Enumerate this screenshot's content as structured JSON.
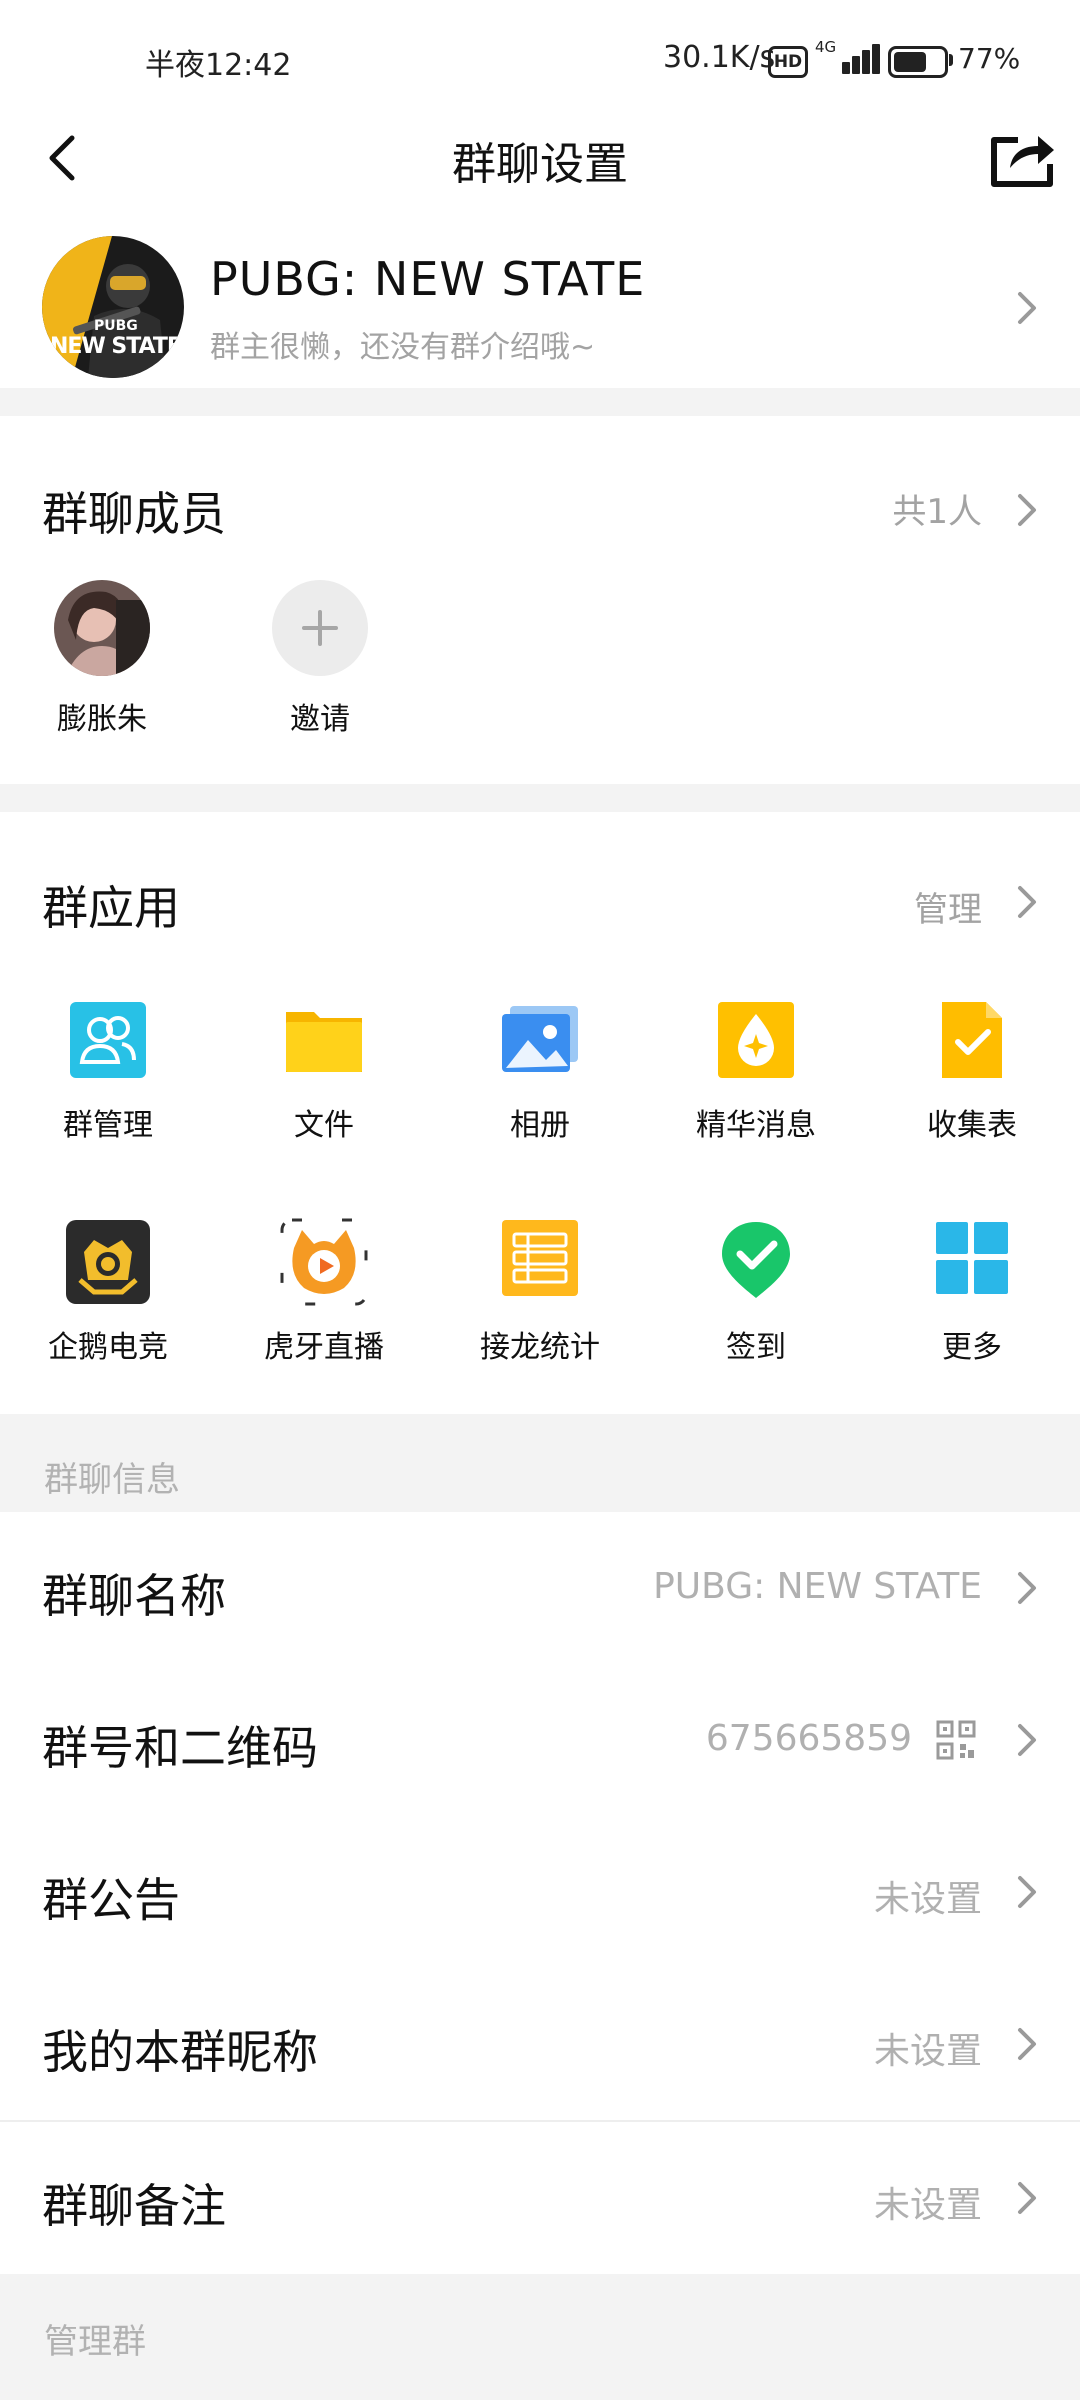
{
  "status_bar": {
    "time": "半夜12:42",
    "net_speed": "30.1K/s",
    "hd": "HD",
    "network": "4G",
    "battery": "77%",
    "battery_level": 0.77
  },
  "header": {
    "title": "群聊设置"
  },
  "group": {
    "name": "PUBG: NEW STATE",
    "intro": "群主很懒，还没有群介绍哦~",
    "avatar_text_top": "PUBG",
    "avatar_text_bottom": "NEW STATE"
  },
  "members": {
    "title": "群聊成员",
    "count": "共1人",
    "list": [
      {
        "name": "膨胀朱"
      },
      {
        "name": "邀请"
      }
    ]
  },
  "apps": {
    "title": "群应用",
    "manage": "管理",
    "items": [
      {
        "label": "群管理",
        "icon": "group-manage-icon"
      },
      {
        "label": "文件",
        "icon": "folder-icon"
      },
      {
        "label": "相册",
        "icon": "photo-album-icon"
      },
      {
        "label": "精华消息",
        "icon": "essence-message-icon"
      },
      {
        "label": "收集表",
        "icon": "collect-form-icon"
      },
      {
        "label": "企鹅电竞",
        "icon": "penguin-esports-icon"
      },
      {
        "label": "虎牙直播",
        "icon": "huya-live-icon"
      },
      {
        "label": "接龙统计",
        "icon": "chain-stats-icon"
      },
      {
        "label": "签到",
        "icon": "check-in-icon"
      },
      {
        "label": "更多",
        "icon": "more-grid-icon"
      }
    ]
  },
  "info": {
    "section_label": "群聊信息",
    "rows": [
      {
        "label": "群聊名称",
        "value": "PUBG: NEW STATE"
      },
      {
        "label": "群号和二维码",
        "value": "675665859"
      },
      {
        "label": "群公告",
        "value": "未设置"
      },
      {
        "label": "我的本群昵称",
        "value": "未设置"
      },
      {
        "label": "群聊备注",
        "value": "未设置"
      }
    ]
  },
  "manage_section": {
    "label": "管理群"
  }
}
